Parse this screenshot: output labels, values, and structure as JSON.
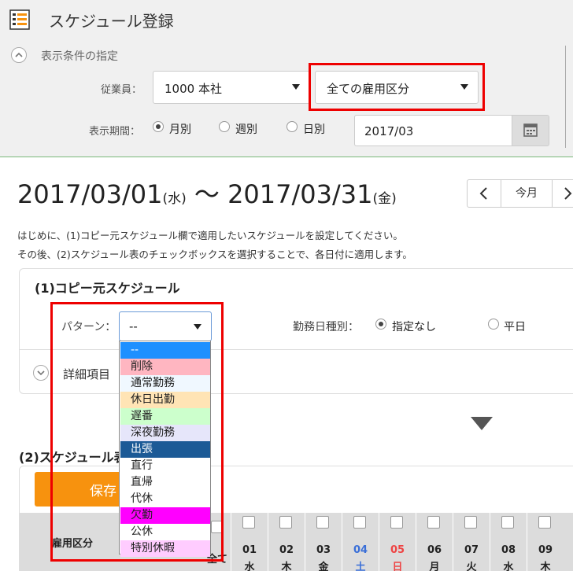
{
  "header": {
    "title": "スケジュール登録",
    "icon": "schedule-list-icon"
  },
  "filter": {
    "heading": "表示条件の指定",
    "employee_label": "従業員：",
    "employee_value": "1000 本社",
    "employment_type_value": "全ての雇用区分",
    "period_label": "表示期間：",
    "period_options": [
      "月別",
      "週別",
      "日別"
    ],
    "period_selected": "月別",
    "date_value": "2017/03"
  },
  "range": {
    "start": "2017/03/01",
    "start_wd": "(水)",
    "sep": "〜",
    "end": "2017/03/31",
    "end_wd": "(金)",
    "prev": "〈",
    "today": "今月",
    "next": "〉"
  },
  "instructions": [
    "はじめに、(1)コピー元スケジュール欄で適用したいスケジュールを設定してください。",
    "その後、(2)スケジュール表のチェックボックスを選択することで、各日付に適用します。"
  ],
  "copy_source": {
    "title": "(1)コピー元スケジュール",
    "pattern_label": "パターン：",
    "pattern_value": "--",
    "day_type_label": "勤務日種別：",
    "day_type_options": [
      "指定なし",
      "平日"
    ],
    "day_type_selected": "指定なし",
    "detail_label": "詳細項目"
  },
  "pattern_options": [
    {
      "label": "--",
      "bg": "#1e90ff",
      "fg": "#ffffff"
    },
    {
      "label": "削除",
      "bg": "#ffb6c1",
      "fg": "#222222"
    },
    {
      "label": "通常勤務",
      "bg": "#f0f8ff",
      "fg": "#222222"
    },
    {
      "label": "休日出勤",
      "bg": "#ffe4b5",
      "fg": "#222222"
    },
    {
      "label": "遅番",
      "bg": "#ccffcc",
      "fg": "#222222"
    },
    {
      "label": "深夜勤務",
      "bg": "#e6e6fa",
      "fg": "#222222"
    },
    {
      "label": "出張",
      "bg": "#1c5a96",
      "fg": "#ffffff"
    },
    {
      "label": "直行",
      "bg": "#ffffff",
      "fg": "#222222"
    },
    {
      "label": "直帰",
      "bg": "#ffffff",
      "fg": "#222222"
    },
    {
      "label": "代休",
      "bg": "#ffffff",
      "fg": "#222222"
    },
    {
      "label": "欠勤",
      "bg": "#ff00ff",
      "fg": "#222222"
    },
    {
      "label": "公休",
      "bg": "#ffffff",
      "fg": "#222222"
    },
    {
      "label": "特別休暇",
      "bg": "#ffccff",
      "fg": "#222222"
    }
  ],
  "schedule": {
    "title": "(2)スケジュール表",
    "save_label": "保存",
    "col_emptype": "雇用区分",
    "col_all": "全て",
    "days": [
      {
        "num": "01",
        "wd": "水",
        "color": "#222222"
      },
      {
        "num": "02",
        "wd": "木",
        "color": "#222222"
      },
      {
        "num": "03",
        "wd": "金",
        "color": "#222222"
      },
      {
        "num": "04",
        "wd": "土",
        "color": "#3a6fd8"
      },
      {
        "num": "05",
        "wd": "日",
        "color": "#ee4444"
      },
      {
        "num": "06",
        "wd": "月",
        "color": "#222222"
      },
      {
        "num": "07",
        "wd": "火",
        "color": "#222222"
      },
      {
        "num": "08",
        "wd": "水",
        "color": "#222222"
      },
      {
        "num": "09",
        "wd": "木",
        "color": "#222222"
      }
    ]
  }
}
